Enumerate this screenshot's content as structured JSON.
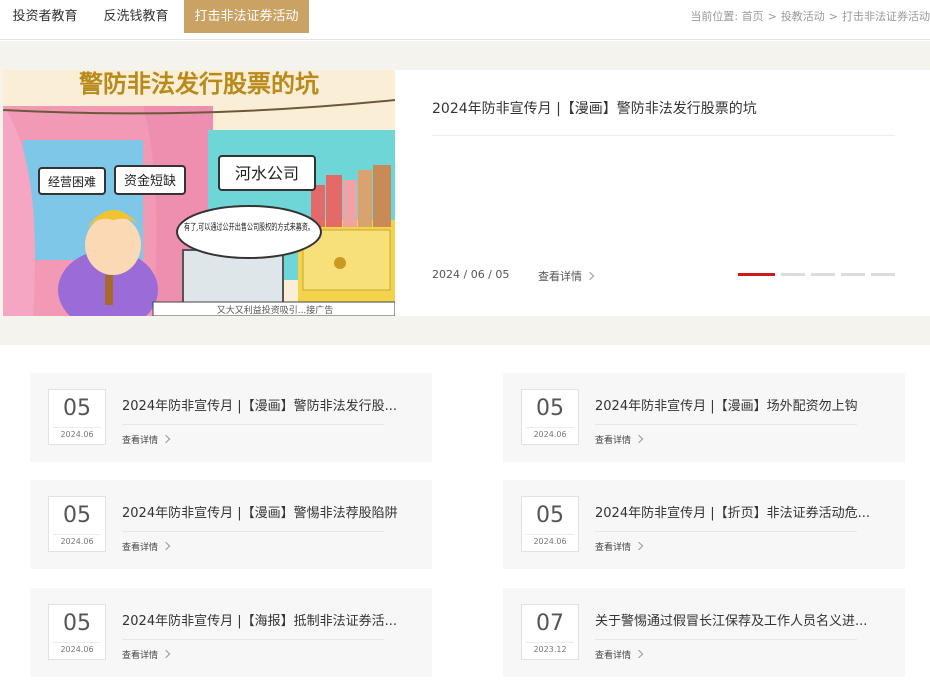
{
  "nav": {
    "tabs": [
      {
        "label": "投资者教育"
      },
      {
        "label": "反洗钱教育"
      },
      {
        "label": "打击非法证券活动"
      }
    ],
    "breadcrumb": {
      "prefix": "当前位置:",
      "items": [
        "首页",
        "投教活动",
        "打击非法证券活动"
      ]
    }
  },
  "hero": {
    "image_caption": "警防非法发行股票的坑",
    "image_bubbles": [
      "经营困难",
      "资金短缺",
      "河水公司"
    ],
    "image_speech": "有了,可以通过公开出售公司股权的方式来募资。",
    "image_bottom": "又大又利益投资吸引...接广告",
    "title": "2024年防非宣传月 |【漫画】警防非法发行股票的坑",
    "date": "2024 / 06 / 05",
    "more": "查看详情",
    "slide_count": 5,
    "active_slide": 0,
    "accent": "#cc1b1b"
  },
  "news": {
    "more_label": "查看详情",
    "items": [
      {
        "day": "05",
        "ym": "2024.06",
        "title": "2024年防非宣传月 |【漫画】警防非法发行股..."
      },
      {
        "day": "05",
        "ym": "2024.06",
        "title": "2024年防非宣传月 |【漫画】场外配资勿上钩"
      },
      {
        "day": "05",
        "ym": "2024.06",
        "title": "2024年防非宣传月 |【漫画】警惕非法荐股陷阱"
      },
      {
        "day": "05",
        "ym": "2024.06",
        "title": "2024年防非宣传月 |【折页】非法证券活动危..."
      },
      {
        "day": "05",
        "ym": "2024.06",
        "title": "2024年防非宣传月 |【海报】抵制非法证券活..."
      },
      {
        "day": "07",
        "ym": "2023.12",
        "title": "关于警惕通过假冒长江保荐及工作人员名义进..."
      }
    ]
  },
  "colors": {
    "tab_active": "#c9a264",
    "band": "#f5f3ee",
    "card": "#f7f7f7"
  }
}
